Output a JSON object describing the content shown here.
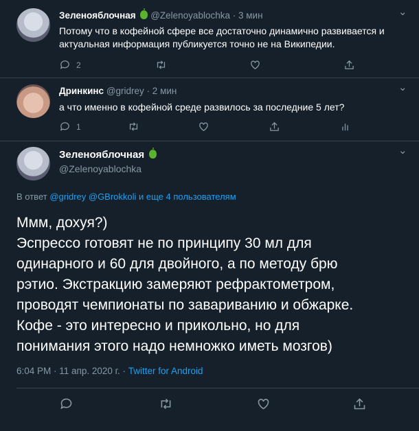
{
  "tweets": [
    {
      "name": "Зеленояблочная",
      "handle": "@Zelenoyablochka",
      "time": "· 3 мин",
      "text_line1": "Потому что в кофейной сфере все достаточно динамично развивается и",
      "text_line2": "актуальная информация публикуется точно не на Википедии.",
      "reply_count": "2"
    },
    {
      "name": "Дринкинс",
      "handle": "@gridrey",
      "time": "· 2 мин",
      "text_line1": "а что именно в кофейной среде развилось за последние 5 лет?",
      "reply_count": "1"
    }
  ],
  "main": {
    "name": "Зеленояблочная",
    "handle": "@Zelenoyablochka",
    "reply_prefix": "В ответ",
    "reply_mentions": "@gridrey @GBrokkoli и еще 4 пользователям",
    "lines": [
      "Ммм, дохуя?)",
      "Эспрессо готовят не по принципу 30 мл для",
      "одинарного и 60 для двойного, а по методу брю",
      "рэтио. Экстракцию  замеряют рефрактометром,",
      "проводят чемпионаты по завариванию и обжарке.",
      "Кофе - это интересно и прикольно, но для",
      "понимания этого надо немножко иметь мозгов)"
    ],
    "timestamp": "6:04 PM · 11 апр. 2020 г. · ",
    "source": "Twitter for Android"
  },
  "icons": [
    "reply-icon",
    "retweet-icon",
    "like-icon",
    "share-icon",
    "analytics-icon",
    "more-icon",
    "apple-emoji-icon"
  ],
  "colors": {
    "background": "#15202b",
    "muted": "#8899a6",
    "link": "#1da1f2",
    "border": "#38444d"
  }
}
